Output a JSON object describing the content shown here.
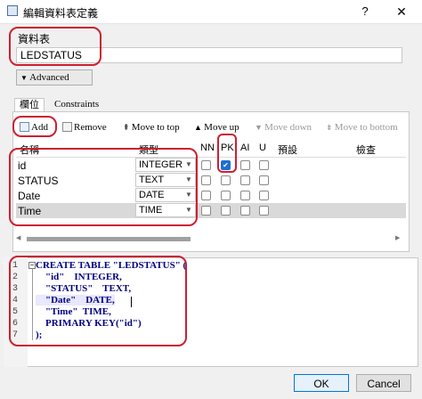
{
  "window": {
    "title": "編輯資料表定義",
    "help": "?",
    "close": "✕"
  },
  "table_section": {
    "label": "資料表",
    "table_name": "LEDSTATUS"
  },
  "advanced_button": "Advanced",
  "tabs": [
    {
      "label": "欄位"
    },
    {
      "label": "Constraints"
    }
  ],
  "toolbar": {
    "add": "Add",
    "remove": "Remove",
    "move_to_top": "Move to top",
    "move_up": "Move up",
    "move_down": "Move down",
    "move_to_bottom": "Move to bottom"
  },
  "columns_header": {
    "name": "名稱",
    "type": "類型",
    "nn": "NN",
    "pk": "PK",
    "ai": "AI",
    "u": "U",
    "default": "預設",
    "check": "檢查"
  },
  "columns": [
    {
      "name": "id",
      "type": "INTEGER",
      "nn": false,
      "pk": true,
      "ai": false,
      "u": false
    },
    {
      "name": "STATUS",
      "type": "TEXT",
      "nn": false,
      "pk": false,
      "ai": false,
      "u": false
    },
    {
      "name": "Date",
      "type": "DATE",
      "nn": false,
      "pk": false,
      "ai": false,
      "u": false
    },
    {
      "name": "Time",
      "type": "TIME",
      "nn": false,
      "pk": false,
      "ai": false,
      "u": false
    }
  ],
  "sql": {
    "line_numbers": [
      "1",
      "2",
      "3",
      "4",
      "5",
      "6",
      "7"
    ],
    "lines": [
      "CREATE TABLE \"LEDSTATUS\" (",
      "    \"id\"    INTEGER,",
      "    \"STATUS\"    TEXT,",
      "    \"Date\"    DATE,",
      "    \"Time\"  TIME,",
      "    PRIMARY KEY(\"id\")",
      ");"
    ]
  },
  "buttons": {
    "ok": "OK",
    "cancel": "Cancel"
  },
  "colors": {
    "annotation": "#cc2030",
    "keyword": "#000080",
    "checkbox_checked": "#1f6fd0"
  }
}
